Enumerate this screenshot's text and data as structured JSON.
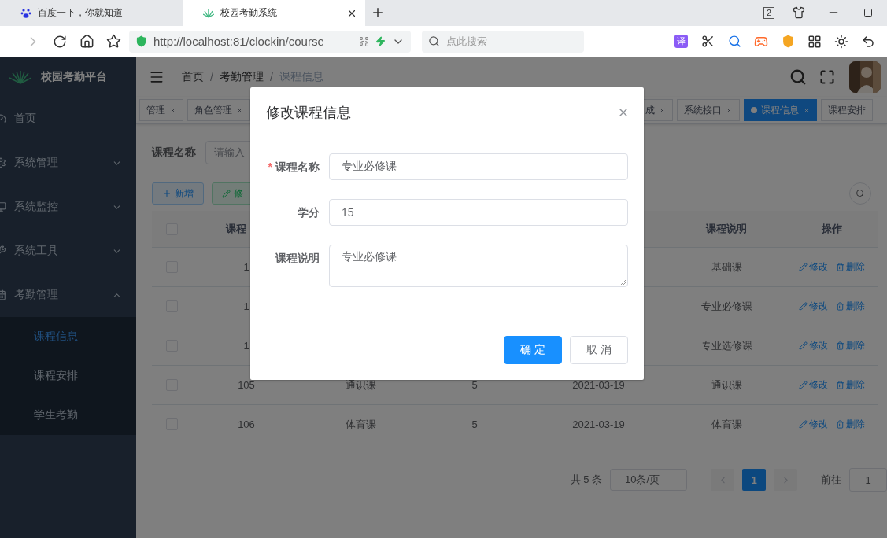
{
  "browser": {
    "tabs": [
      {
        "title": "百度一下，你就知道",
        "selected": false
      },
      {
        "title": "校园考勤系统",
        "selected": true
      }
    ],
    "tab_count": "2",
    "url": "http://localhost:81/clockin/course",
    "search": {
      "placeholder": "点此搜索"
    },
    "translate_badge": "译"
  },
  "sidebar": {
    "title": "校园考勤平台",
    "items": [
      {
        "label": "首页",
        "kind": "link"
      },
      {
        "label": "系统管理",
        "kind": "submenu",
        "expanded": false
      },
      {
        "label": "系统监控",
        "kind": "submenu",
        "expanded": false
      },
      {
        "label": "系统工具",
        "kind": "submenu",
        "expanded": false
      },
      {
        "label": "考勤管理",
        "kind": "submenu",
        "expanded": true,
        "children": [
          {
            "label": "课程信息",
            "selected": true
          },
          {
            "label": "课程安排",
            "selected": false
          },
          {
            "label": "学生考勤",
            "selected": false
          }
        ]
      }
    ]
  },
  "header": {
    "breadcrumb": [
      {
        "label": "首页",
        "current": false
      },
      {
        "separator": "/",
        "label": "考勤管理",
        "current": false
      },
      {
        "separator": "/",
        "label": "课程信息",
        "current": true
      }
    ]
  },
  "tags": [
    {
      "label": "管理",
      "selected": false
    },
    {
      "label": "角色管理",
      "selected": false
    },
    {
      "label": "成",
      "selected": false
    },
    {
      "label": "系统接口",
      "selected": false
    },
    {
      "label": "课程信息",
      "selected": true
    },
    {
      "label": "课程安排",
      "selected": false
    }
  ],
  "search_form": {
    "label": "课程名称",
    "placeholder": "请输入"
  },
  "toolbar": {
    "buttons": [
      {
        "label": "新增",
        "kind": "add"
      },
      {
        "label": "修",
        "kind": "edit"
      }
    ]
  },
  "table": {
    "header_checked": false,
    "header_cells": [
      "课程",
      "",
      "",
      "",
      "课程说明",
      "操作"
    ],
    "rows": [
      {
        "checked": false,
        "cells": [
          "1",
          "",
          "",
          "",
          "基础课"
        ],
        "actions": [
          "修改",
          "删除"
        ]
      },
      {
        "checked": false,
        "cells": [
          "1",
          "",
          "",
          "",
          "专业必修课"
        ],
        "actions": [
          "修改",
          "删除"
        ]
      },
      {
        "checked": false,
        "cells": [
          "1",
          "",
          "",
          "",
          "专业选修课"
        ],
        "actions": [
          "修改",
          "删除"
        ]
      },
      {
        "checked": false,
        "cells": [
          "105",
          "通识课",
          "5",
          "2021-03-19",
          "通识课"
        ],
        "actions": [
          "修改",
          "删除"
        ]
      },
      {
        "checked": false,
        "cells": [
          "106",
          "体育课",
          "5",
          "2021-03-19",
          "体育课"
        ],
        "actions": [
          "修改",
          "删除"
        ]
      }
    ]
  },
  "pagination": {
    "total": "共 5 条",
    "page_size": "10条/页",
    "pages": [
      {
        "label": "1",
        "selected": true
      }
    ],
    "goto_label": "前往",
    "goto_value": "1"
  },
  "dialog": {
    "title": "修改课程信息",
    "fields": [
      {
        "label": "课程名称",
        "required_mark": "*",
        "kind": "input",
        "value": "专业必修课"
      },
      {
        "label": "学分",
        "kind": "input",
        "value": "15"
      },
      {
        "label": "课程说明",
        "kind": "textarea",
        "value": "专业必修课"
      }
    ],
    "buttons": [
      {
        "label": "确 定",
        "primary": true
      },
      {
        "label": "取 消",
        "primary": false
      }
    ]
  }
}
